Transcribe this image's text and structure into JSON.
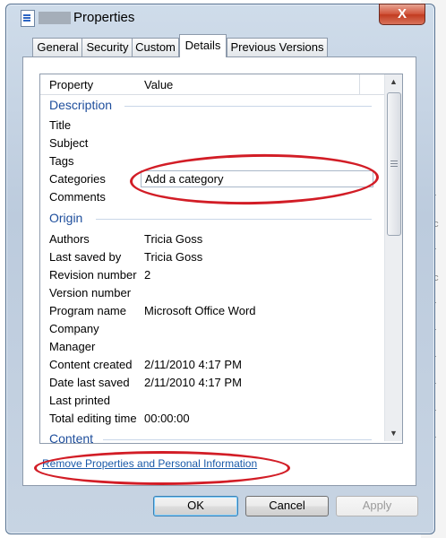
{
  "window": {
    "title": "Properties",
    "close_glyph": "X"
  },
  "tabs": [
    {
      "label": "General",
      "active": false
    },
    {
      "label": "Security",
      "active": false
    },
    {
      "label": "Custom",
      "active": false
    },
    {
      "label": "Details",
      "active": true
    },
    {
      "label": "Previous Versions",
      "active": false
    }
  ],
  "list": {
    "headers": {
      "property": "Property",
      "value": "Value"
    },
    "groups": {
      "description": "Description",
      "origin": "Origin",
      "content": "Content"
    },
    "rows": [
      {
        "property": "Title",
        "value": ""
      },
      {
        "property": "Subject",
        "value": ""
      },
      {
        "property": "Tags",
        "value": ""
      },
      {
        "property": "Categories",
        "value": "Add a category"
      },
      {
        "property": "Comments",
        "value": ""
      },
      {
        "property": "Authors",
        "value": "Tricia Goss"
      },
      {
        "property": "Last saved by",
        "value": "Tricia Goss"
      },
      {
        "property": "Revision number",
        "value": "2"
      },
      {
        "property": "Version number",
        "value": ""
      },
      {
        "property": "Program name",
        "value": "Microsoft Office Word"
      },
      {
        "property": "Company",
        "value": ""
      },
      {
        "property": "Manager",
        "value": ""
      },
      {
        "property": "Content created",
        "value": "2/11/2010 4:17 PM"
      },
      {
        "property": "Date last saved",
        "value": "2/11/2010 4:17 PM"
      },
      {
        "property": "Last printed",
        "value": ""
      },
      {
        "property": "Total editing time",
        "value": "00:00:00"
      }
    ]
  },
  "link": {
    "text": "Remove Properties and Personal Information"
  },
  "buttons": {
    "ok": "OK",
    "cancel": "Cancel",
    "apply": "Apply"
  },
  "icons": {
    "title": "document-icon",
    "scroll_up": "chevron-up-icon",
    "scroll_down": "chevron-down-icon",
    "close": "close-icon"
  },
  "colors": {
    "group_heading": "#1e4e9c",
    "link": "#1a5aa9",
    "annotation": "#d21d26"
  }
}
